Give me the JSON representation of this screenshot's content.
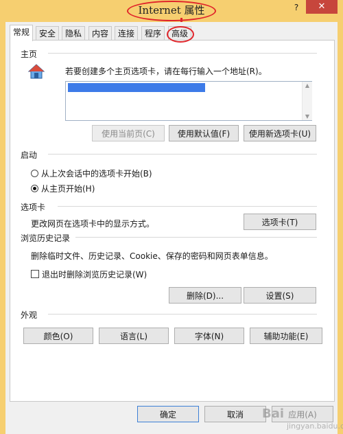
{
  "window": {
    "title": "Internet 属性",
    "help_label": "?",
    "close_label": "✕"
  },
  "tabs": [
    {
      "label": "常规"
    },
    {
      "label": "安全"
    },
    {
      "label": "隐私"
    },
    {
      "label": "内容"
    },
    {
      "label": "连接"
    },
    {
      "label": "程序"
    },
    {
      "label": "高级"
    }
  ],
  "home": {
    "heading": "主页",
    "description": "若要创建多个主页选项卡，请在每行输入一个地址(R)。",
    "btn_current": "使用当前页(C)",
    "btn_default": "使用默认值(F)",
    "btn_newtab": "使用新选项卡(U)"
  },
  "startup": {
    "heading": "启动",
    "option_last_session": "从上次会话中的选项卡开始(B)",
    "option_home": "从主页开始(H)"
  },
  "tabs_section": {
    "heading": "选项卡",
    "description": "更改网页在选项卡中的显示方式。",
    "button": "选项卡(T)"
  },
  "history": {
    "heading": "浏览历史记录",
    "description": "删除临时文件、历史记录、Cookie、保存的密码和网页表单信息。",
    "checkbox_label": "退出时删除浏览历史记录(W)",
    "btn_delete": "删除(D)...",
    "btn_settings": "设置(S)"
  },
  "appearance": {
    "heading": "外观",
    "btn_colors": "颜色(O)",
    "btn_languages": "语言(L)",
    "btn_fonts": "字体(N)",
    "btn_accessibility": "辅助功能(E)"
  },
  "footer": {
    "ok": "确定",
    "cancel": "取消",
    "apply": "应用(A)"
  },
  "watermark": {
    "brand": "Bai",
    "sub": "jingyan.baidu.com"
  }
}
